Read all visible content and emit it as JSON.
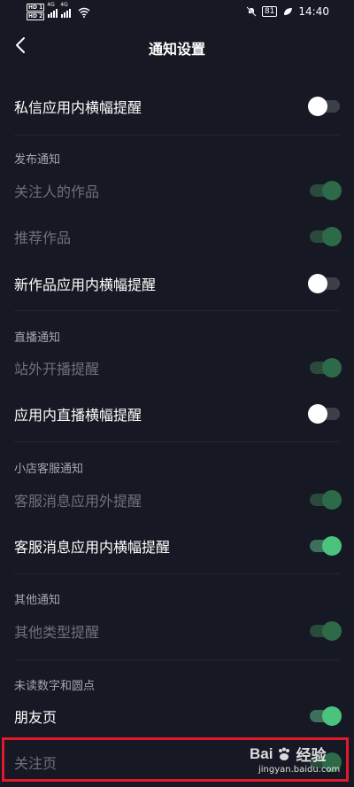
{
  "status_bar": {
    "time": "14:40",
    "battery": "81",
    "sim1_badge": "HD 1",
    "sim2_badge": "HD 2",
    "network": "4G"
  },
  "navbar": {
    "title": "通知设置"
  },
  "rows": {
    "dm_banner": {
      "label": "私信应用内横幅提醒",
      "state": "off"
    },
    "followed_works": {
      "label": "关注人的作品",
      "state": "on-disabled"
    },
    "recommended_works": {
      "label": "推荐作品",
      "state": "on-disabled"
    },
    "new_works_banner": {
      "label": "新作品应用内横幅提醒",
      "state": "off"
    },
    "offsite_live": {
      "label": "站外开播提醒",
      "state": "on-disabled"
    },
    "inapp_live_banner": {
      "label": "应用内直播横幅提醒",
      "state": "off"
    },
    "cs_outside": {
      "label": "客服消息应用外提醒",
      "state": "on-disabled"
    },
    "cs_inapp_banner": {
      "label": "客服消息应用内横幅提醒",
      "state": "on"
    },
    "other_types": {
      "label": "其他类型提醒",
      "state": "on-disabled"
    },
    "friends_page": {
      "label": "朋友页",
      "state": "on"
    },
    "following_page": {
      "label": "关注页",
      "state": "on-disabled"
    }
  },
  "sections": {
    "publish": "发布通知",
    "live": "直播通知",
    "shop": "小店客服通知",
    "other": "其他通知",
    "unread": "未读数字和圆点"
  },
  "watermark": {
    "brand": "Bai",
    "brand_suffix": "经验",
    "url": "jingyan.baidu.com"
  },
  "colors": {
    "background": "#161823",
    "toggle_on": "#4ac37e",
    "highlight": "#e0192d"
  }
}
